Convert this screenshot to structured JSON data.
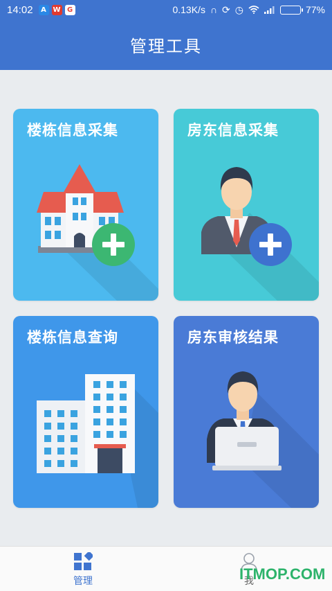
{
  "status_bar": {
    "time": "14:02",
    "network_speed": "0.13K/s",
    "battery": "77%",
    "battery_level": 0.77,
    "notification_icons": [
      "app-notification-icon",
      "weibo-icon",
      "google-icon"
    ],
    "status_icons": [
      "headphones-icon",
      "sync-icon",
      "alarm-icon",
      "wifi-icon",
      "signal-icon"
    ]
  },
  "header": {
    "title": "管理工具"
  },
  "cards": [
    {
      "label": "楼栋信息采集",
      "icon": "building-add-icon",
      "color": "#4cb9ef"
    },
    {
      "label": "房东信息采集",
      "icon": "landlord-add-icon",
      "color": "#47cad7"
    },
    {
      "label": "楼栋信息查询",
      "icon": "building-query-icon",
      "color": "#3f97ea"
    },
    {
      "label": "房东审核结果",
      "icon": "landlord-review-icon",
      "color": "#4a7bd6"
    }
  ],
  "bottom_nav": [
    {
      "label": "管理",
      "icon": "grid-icon",
      "active": true
    },
    {
      "label": "我",
      "icon": "person-icon",
      "active": false
    }
  ],
  "watermark": "ITMOP.COM",
  "colors": {
    "primary": "#3f74cf",
    "add_green": "#3cb772",
    "add_blue": "#3e72cf"
  }
}
